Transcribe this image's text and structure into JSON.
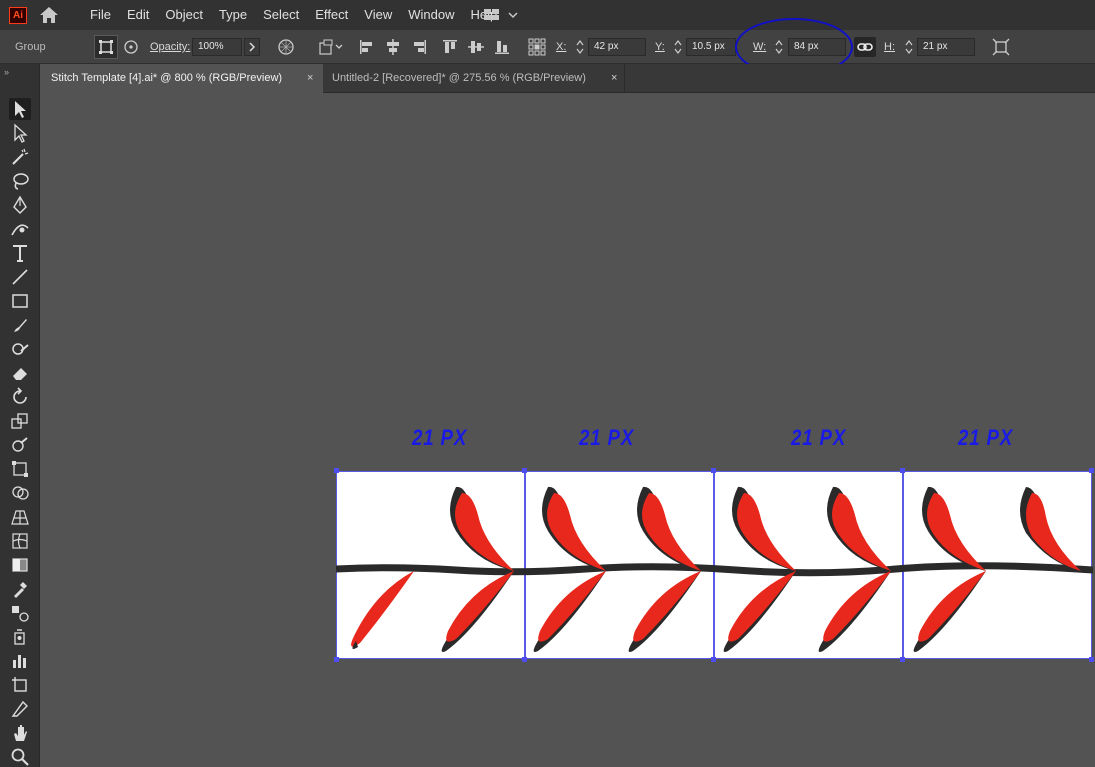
{
  "app": {
    "logo_text": "Ai"
  },
  "menu": [
    "File",
    "Edit",
    "Object",
    "Type",
    "Select",
    "Effect",
    "View",
    "Window",
    "Help"
  ],
  "control_bar": {
    "selection_type": "Group",
    "opacity_label": "Opacity:",
    "opacity_value": "100%",
    "x_label": "X:",
    "x_value": "42 px",
    "y_label": "Y:",
    "y_value": "10.5 px",
    "w_label": "W:",
    "w_value": "84 px",
    "h_label": "H:",
    "h_value": "21 px"
  },
  "tabs": [
    {
      "label": "Stitch Template [4].ai* @ 800 % (RGB/Preview)",
      "close": "×"
    },
    {
      "label": "Untitled-2 [Recovered]* @ 275.56 % (RGB/Preview)",
      "close": "×"
    }
  ],
  "tools": [
    "selection-tool",
    "direct-selection-tool",
    "magic-wand-tool",
    "lasso-tool",
    "pen-tool",
    "curvature-tool",
    "type-tool",
    "line-tool",
    "rectangle-tool",
    "paintbrush-tool",
    "shaper-tool",
    "eraser-tool",
    "rotate-tool",
    "scale-tool",
    "warp-tool",
    "free-transform-tool",
    "shape-builder-tool",
    "perspective-grid-tool",
    "mesh-tool",
    "gradient-tool",
    "eyedropper-tool",
    "blend-tool",
    "symbol-sprayer-tool",
    "column-graph-tool",
    "artboard-tool",
    "slice-tool",
    "hand-tool",
    "zoom-tool"
  ],
  "annotations": [
    "21 PX",
    "21 PX",
    "21 PX",
    "21 PX"
  ],
  "colors": {
    "annotation": "#1a1ae6",
    "stitch_red": "#e8281c",
    "stitch_dark": "#2a2a2a",
    "selection": "#4d4df0"
  }
}
